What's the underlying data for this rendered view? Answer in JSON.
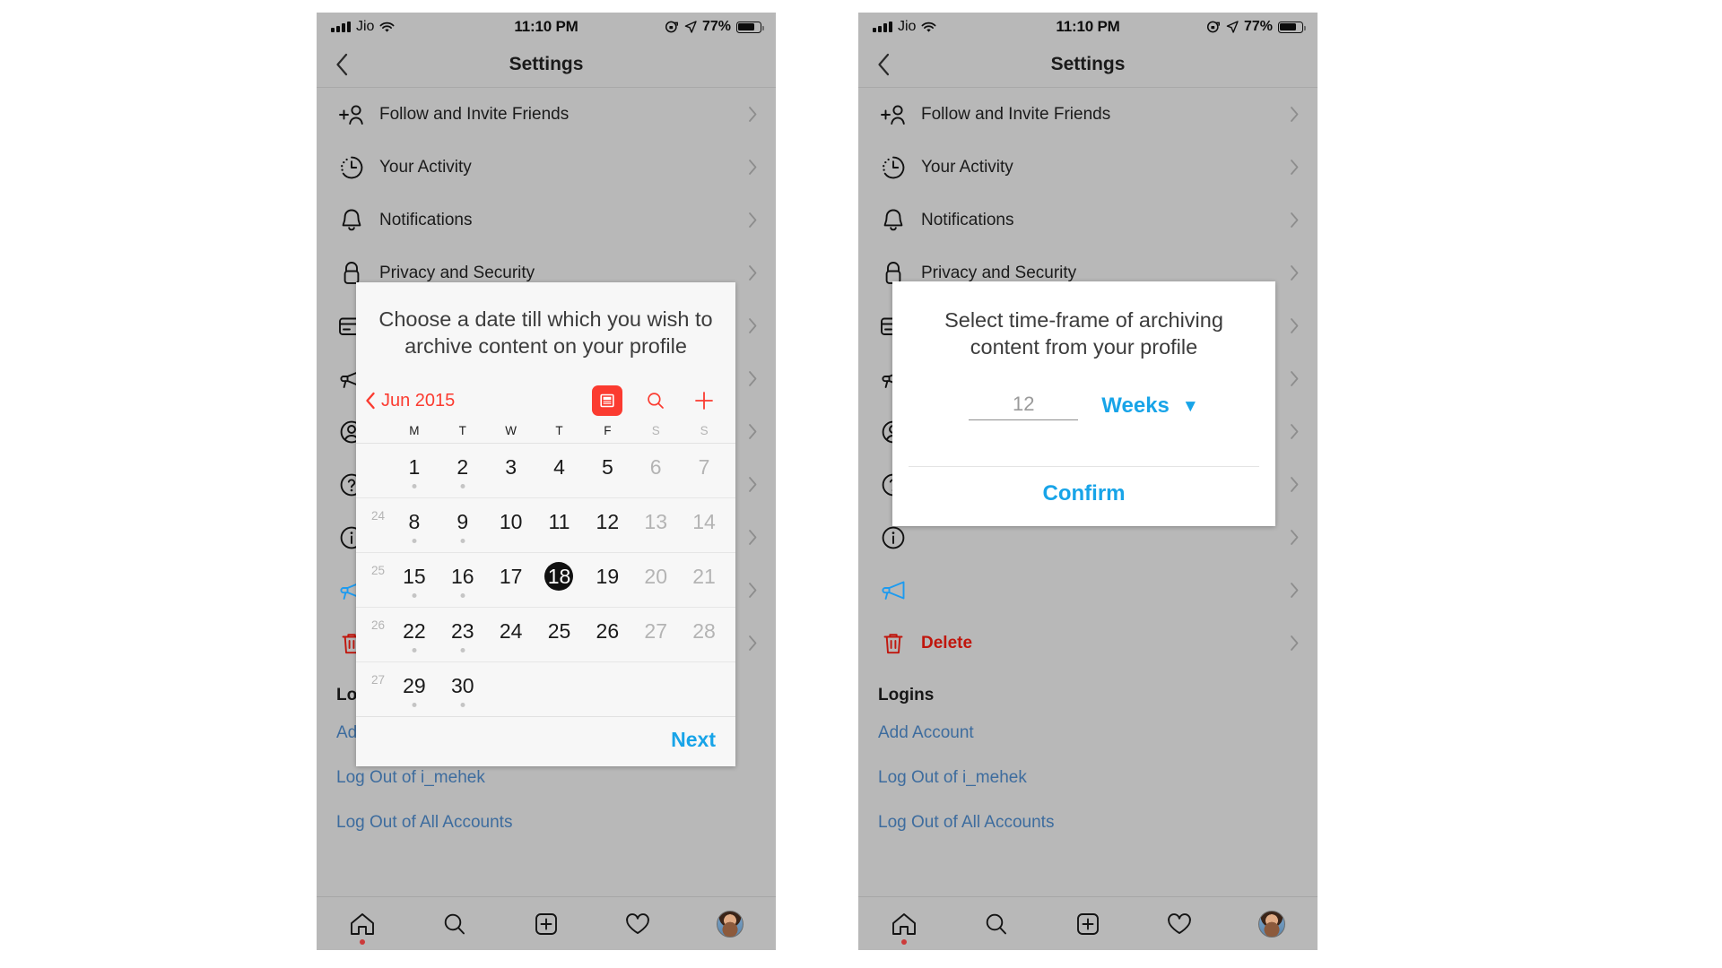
{
  "status_bar": {
    "carrier": "Jio",
    "time": "11:10 PM",
    "battery_percent": "77%",
    "icons": [
      "signal-bars-icon",
      "wifi-icon",
      "rotation-lock-icon",
      "location-arrow-icon",
      "battery-icon"
    ]
  },
  "nav": {
    "title": "Settings",
    "back_icon": "chevron-left-icon"
  },
  "settings": {
    "items": [
      {
        "label": "Follow and Invite Friends",
        "icon": "add-person-icon",
        "style": "normal"
      },
      {
        "label": "Your Activity",
        "icon": "activity-clock-icon",
        "style": "normal"
      },
      {
        "label": "Notifications",
        "icon": "bell-icon",
        "style": "normal"
      },
      {
        "label": "Privacy and Security",
        "icon": "lock-icon",
        "style": "normal"
      },
      {
        "label": "",
        "icon": "credit-card-icon",
        "style": "normal"
      },
      {
        "label": "",
        "icon": "megaphone-icon",
        "style": "normal"
      },
      {
        "label": "",
        "icon": "account-circle-icon",
        "style": "normal"
      },
      {
        "label": "",
        "icon": "help-circle-icon",
        "style": "normal"
      },
      {
        "label": "",
        "icon": "info-circle-icon",
        "style": "normal"
      },
      {
        "label": "",
        "icon": "megaphone-blue-icon",
        "style": "accent"
      },
      {
        "label": "Delete",
        "icon": "trash-icon",
        "style": "danger"
      }
    ],
    "logins_heading": "Logins",
    "login_links": [
      "Add Account",
      "Log Out of i_mehek",
      "Log Out of All Accounts"
    ]
  },
  "tabbar": {
    "items": [
      {
        "name": "home-icon",
        "badge": true
      },
      {
        "name": "search-icon",
        "badge": false
      },
      {
        "name": "add-post-icon",
        "badge": false
      },
      {
        "name": "heart-icon",
        "badge": false
      },
      {
        "name": "profile-avatar",
        "badge": false
      }
    ]
  },
  "calendar_dialog": {
    "title": "Choose a date till which you wish to archive content on your profile",
    "month_label": "Jun 2015",
    "prev_icon": "chevron-left-icon",
    "tools": [
      {
        "name": "list-view-icon",
        "state": "active"
      },
      {
        "name": "search-icon",
        "state": "default"
      },
      {
        "name": "plus-icon",
        "state": "default"
      }
    ],
    "day_headers": [
      "M",
      "T",
      "W",
      "T",
      "F",
      "S",
      "S"
    ],
    "weeks": [
      {
        "week_number": "",
        "days": [
          {
            "d": "1",
            "dim": false,
            "selected": false,
            "event": true
          },
          {
            "d": "2",
            "dim": false,
            "selected": false,
            "event": true
          },
          {
            "d": "3",
            "dim": false,
            "selected": false,
            "event": false
          },
          {
            "d": "4",
            "dim": false,
            "selected": false,
            "event": false
          },
          {
            "d": "5",
            "dim": false,
            "selected": false,
            "event": false
          },
          {
            "d": "6",
            "dim": true,
            "selected": false,
            "event": false
          },
          {
            "d": "7",
            "dim": true,
            "selected": false,
            "event": false
          }
        ]
      },
      {
        "week_number": "24",
        "days": [
          {
            "d": "8",
            "dim": false,
            "selected": false,
            "event": true
          },
          {
            "d": "9",
            "dim": false,
            "selected": false,
            "event": true
          },
          {
            "d": "10",
            "dim": false,
            "selected": false,
            "event": false
          },
          {
            "d": "11",
            "dim": false,
            "selected": false,
            "event": false
          },
          {
            "d": "12",
            "dim": false,
            "selected": false,
            "event": false
          },
          {
            "d": "13",
            "dim": true,
            "selected": false,
            "event": false
          },
          {
            "d": "14",
            "dim": true,
            "selected": false,
            "event": false
          }
        ]
      },
      {
        "week_number": "25",
        "days": [
          {
            "d": "15",
            "dim": false,
            "selected": false,
            "event": true
          },
          {
            "d": "16",
            "dim": false,
            "selected": false,
            "event": true
          },
          {
            "d": "17",
            "dim": false,
            "selected": false,
            "event": false
          },
          {
            "d": "18",
            "dim": false,
            "selected": true,
            "event": false
          },
          {
            "d": "19",
            "dim": false,
            "selected": false,
            "event": false
          },
          {
            "d": "20",
            "dim": true,
            "selected": false,
            "event": false
          },
          {
            "d": "21",
            "dim": true,
            "selected": false,
            "event": false
          }
        ]
      },
      {
        "week_number": "26",
        "days": [
          {
            "d": "22",
            "dim": false,
            "selected": false,
            "event": true
          },
          {
            "d": "23",
            "dim": false,
            "selected": false,
            "event": true
          },
          {
            "d": "24",
            "dim": false,
            "selected": false,
            "event": false
          },
          {
            "d": "25",
            "dim": false,
            "selected": false,
            "event": false
          },
          {
            "d": "26",
            "dim": false,
            "selected": false,
            "event": false
          },
          {
            "d": "27",
            "dim": true,
            "selected": false,
            "event": false
          },
          {
            "d": "28",
            "dim": true,
            "selected": false,
            "event": false
          }
        ]
      },
      {
        "week_number": "27",
        "days": [
          {
            "d": "29",
            "dim": false,
            "selected": false,
            "event": true
          },
          {
            "d": "30",
            "dim": false,
            "selected": false,
            "event": true
          },
          {
            "d": "",
            "dim": false,
            "selected": false,
            "event": false
          },
          {
            "d": "",
            "dim": false,
            "selected": false,
            "event": false
          },
          {
            "d": "",
            "dim": false,
            "selected": false,
            "event": false
          },
          {
            "d": "",
            "dim": false,
            "selected": false,
            "event": false
          },
          {
            "d": "",
            "dim": false,
            "selected": false,
            "event": false
          }
        ]
      }
    ],
    "next_label": "Next"
  },
  "timeframe_dialog": {
    "title": "Select time-frame of archiving content from your profile",
    "amount_value": "12",
    "unit_label": "Weeks",
    "unit_caret_icon": "caret-down-icon",
    "confirm_label": "Confirm"
  },
  "colors": {
    "screen_gray": "#b8b8b8",
    "accent_blue": "#18a4e8",
    "link_blue": "#3d6c9e",
    "calendar_red": "#fb3b30",
    "danger_red": "#c0160d",
    "dialog_bg": "#f7f7f7"
  }
}
